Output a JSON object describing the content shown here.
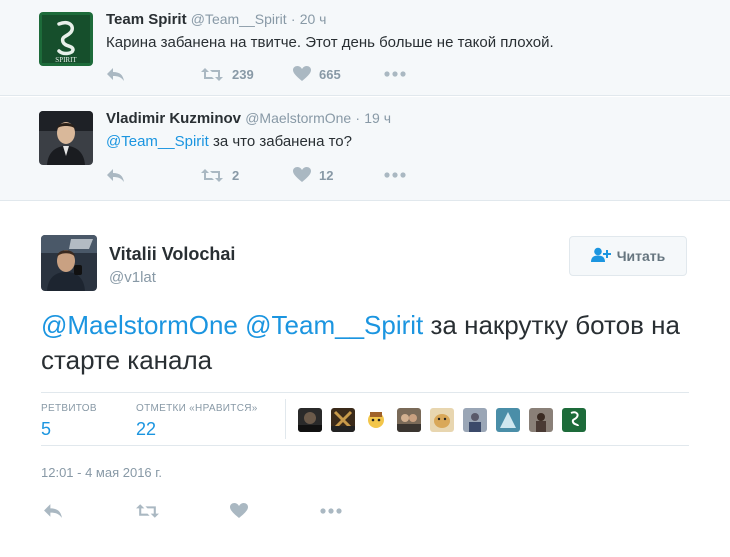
{
  "replies": [
    {
      "name": "Team Spirit",
      "handle": "@Team__Spirit",
      "separator": "·",
      "time": "20 ч",
      "text": "Карина забанена на твитче. Этот день больше не такой плохой.",
      "retweets": "239",
      "likes": "665",
      "avatar_text": "SPIRIT"
    },
    {
      "name": "Vladimir Kuzminov",
      "handle": "@MaelstormOne",
      "separator": "·",
      "time": "19 ч",
      "mention": "@Team__Spirit",
      "text": " за что забанена то?",
      "retweets": "2",
      "likes": "12"
    }
  ],
  "main_tweet": {
    "name": "Vitalii Volochai",
    "handle": "@v1lat",
    "follow_label": "Читать",
    "mention1": "@MaelstormOne",
    "mention2": "@Team__Spirit",
    "text": " за накрутку ботов на старте канала",
    "retweets_label": "РЕТВИТОВ",
    "retweets_count": "5",
    "likes_label": "ОТМЕТКИ «НРАВИТСЯ»",
    "likes_count": "22",
    "timestamp": "12:01 - 4 мая 2016 г."
  },
  "colors": {
    "link": "#1b95e0",
    "muted": "#8899a6",
    "icon": "#aab8c2",
    "reply_bg": "#f5f8fa",
    "spirit_green": "#1d6b3a"
  },
  "icons": {
    "reply": "reply-icon",
    "retweet": "retweet-icon",
    "like": "heart-icon",
    "more": "more-icon",
    "follow": "follow-person-icon"
  }
}
